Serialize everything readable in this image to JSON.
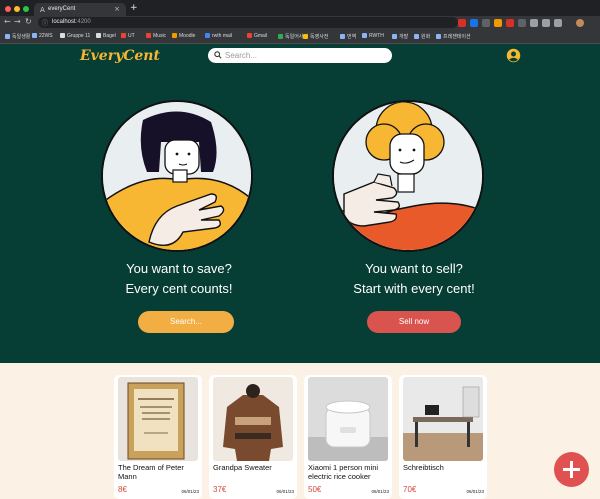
{
  "browser": {
    "tab_title": "everyCent",
    "tab_favicon": "A",
    "tab_close": "×",
    "new_tab": "+",
    "url_host": "localhost",
    "url_port": ":4200",
    "back": "←",
    "forward": "→",
    "reload": "↻",
    "bookmarks": [
      {
        "label": "독일생활",
        "color": "#8ab4f8"
      },
      {
        "label": "22WS",
        "color": "#8ab4f8"
      },
      {
        "label": "Gruppe 11",
        "color": "#dadce0"
      },
      {
        "label": "Bagel",
        "color": "#dadce0"
      },
      {
        "label": "UT",
        "color": "#ea4335"
      },
      {
        "label": "Music",
        "color": "#ea4335"
      },
      {
        "label": "Moodle",
        "color": "#f29900"
      },
      {
        "label": "rwth mail",
        "color": "#4285f4"
      },
      {
        "label": "Gmail",
        "color": "#ea4335"
      },
      {
        "label": "독일어사전",
        "color": "#34a853"
      },
      {
        "label": "독영사전",
        "color": "#fbbc04"
      },
      {
        "label": "번역",
        "color": "#8ab4f8"
      },
      {
        "label": "RWTH",
        "color": "#8ab4f8"
      },
      {
        "label": "개발",
        "color": "#8ab4f8"
      },
      {
        "label": "원화",
        "color": "#8ab4f8"
      },
      {
        "label": "프레젠테이션",
        "color": "#8ab4f8"
      }
    ]
  },
  "header": {
    "logo": "EveryCent",
    "search_placeholder": "Search..."
  },
  "hero": {
    "left": {
      "line1": "You want to save?",
      "line2": "Every cent counts!",
      "button": "Search..."
    },
    "right": {
      "line1": "You want to sell?",
      "line2": "Start with every cent!",
      "button": "Sell now"
    }
  },
  "listings": [
    {
      "title": "The Dream of Peter Mann",
      "price": "8€",
      "date": "06/01/23",
      "image": "book"
    },
    {
      "title": "Grandpa Sweater",
      "price": "37€",
      "date": "06/01/23",
      "image": "sweater"
    },
    {
      "title": "Xiaomi 1 person mini electric rice cooker",
      "price": "50€",
      "date": "06/01/23",
      "image": "rice-cooker"
    },
    {
      "title": "Schreibtisch",
      "price": "70€",
      "date": "06/01/23",
      "image": "desk"
    }
  ],
  "fab_label": "+",
  "colors": {
    "hero_bg": "#063d35",
    "accent_yellow": "#f7b733",
    "accent_red": "#d9534f",
    "page_bg": "#fbf1e5"
  }
}
